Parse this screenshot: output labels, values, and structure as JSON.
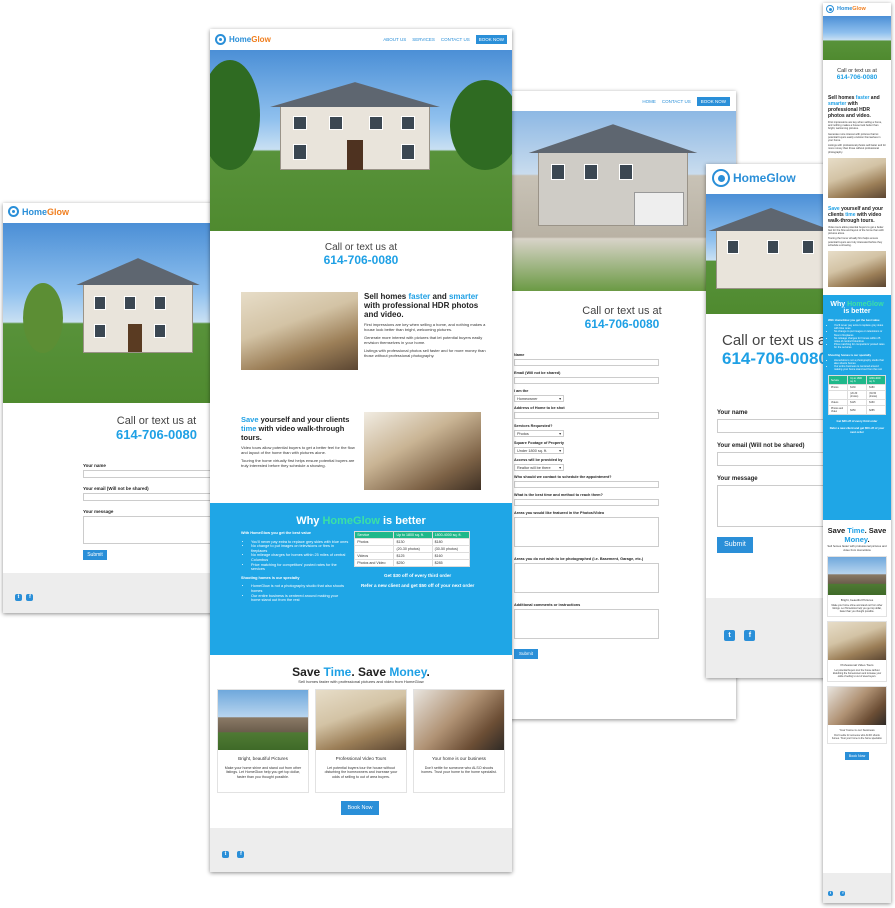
{
  "brand": {
    "name_part1": "Home",
    "name_part2": "Glow",
    "accent": "#2a8fd8",
    "green": "#1fb88a",
    "section_blue": "#1fa6e6"
  },
  "nav": {
    "about": "ABOUT US",
    "services": "SERVICES",
    "home": "HOME",
    "contact": "CONTACT US",
    "book": "BOOK NOW"
  },
  "cta": {
    "line1": "Call or text us at",
    "phone": "614-706-0080"
  },
  "sections": {
    "hdr": {
      "t1": "Sell homes ",
      "t2": "faster",
      "t3": " and ",
      "t4": "smarter",
      "t5": " with professional HDR photos and video.",
      "p1": "First impressions are key when selling a home, and nothing makes a house look better than bright, welcoming pictures.",
      "p2": "Generate more interest with pictures that let potential buyers easily envision themselves in your home.",
      "p3": "Listings with professional photos sell faster and for more money than those without professional photography."
    },
    "video": {
      "t1": "Save",
      "t2": " yourself and your clients ",
      "t3": "time",
      "t4": " with video walk-through tours.",
      "p1": "Video tours allow potential buyers to get a better feel for the flow and layout of the home than with pictures alone.",
      "p2": "Touring the home virtually first helps ensure potential buyers are truly interested before they schedule a showing."
    },
    "why": {
      "t1": "Why ",
      "t2": "HomeGlow",
      "t3": " is better",
      "h1": "With HomeGlow you get the best value",
      "list1": [
        "You'll never pay extra to replace grey skies with blue ones",
        "No change to put images on televisions or fires in fireplaces",
        "No mileage charges for homes within 25 miles of central Columbus",
        "Price matching for competitors' posted rates for the services"
      ],
      "h2": "Shooting homes is our specialty",
      "list2": [
        "HomeGlow is not a photography studio that also shoots homes",
        "Our entire business is centered around making your home stand out from the rest"
      ],
      "offer1": "Get $30 off of every third order",
      "offer2": "Refer a new client and get $50 off of your next order"
    },
    "save": {
      "t1": "Save ",
      "t2": "Time",
      "t3": ". Save ",
      "t4": "Money",
      "t5": ".",
      "sub": "Sell homes faster with professional pictures and video from HomeGlow",
      "cards": [
        {
          "title": "Bright, beautiful Pictures",
          "text": "Make your home shine and stand out from other listings. Let HomeGlow help you get top dollar, faster than you thought possible."
        },
        {
          "title": "Professional Video Tours",
          "text": "Let potential buyers tour the house without disturbing the homeowners and increase your odds of selling to out of area buyers."
        },
        {
          "title": "Your home is our business",
          "text": "Don't settle for someone who ALSO shoots homes. Trust your home to the home specialist."
        }
      ],
      "book": "Book Now"
    }
  },
  "pricing": {
    "headers": [
      "Service",
      "Up to 1800 sq. ft.",
      "1800-4000 sq. ft."
    ],
    "rows": [
      [
        "Photos",
        "$130",
        "$180"
      ],
      [
        "",
        "(20-30 photos)",
        "(30-50 photos)"
      ],
      [
        "Videos",
        "$125",
        "$160"
      ],
      [
        "Photos and Video",
        "$250",
        "$285"
      ]
    ]
  },
  "contact_form": {
    "name": "Your name",
    "email": "Your email (Will not be shared)",
    "message": "Your message",
    "submit": "Submit"
  },
  "booking_form": {
    "fields": [
      "Name",
      "Email (Will not be shared)",
      "I am the",
      "Address of Home to be shot",
      "Services Requested?",
      "Square Footage of Property",
      "Access will be provided by",
      "Who should we contact to schedule the appointment?",
      "What is the best time and method to reach them?",
      "Areas you would like featured in the Photos/Video",
      "Areas you do not wish to be photographed (i.e. Basement, Garage, etc.)",
      "Additional comments or instructions"
    ],
    "iam": "Homeowner",
    "services": "Photos",
    "sqft": "Under 1800 sq. ft.",
    "access": "Realtor will be there",
    "submit": "Submit"
  },
  "icons": {
    "twitter": "twitter-icon",
    "facebook": "facebook-icon"
  }
}
